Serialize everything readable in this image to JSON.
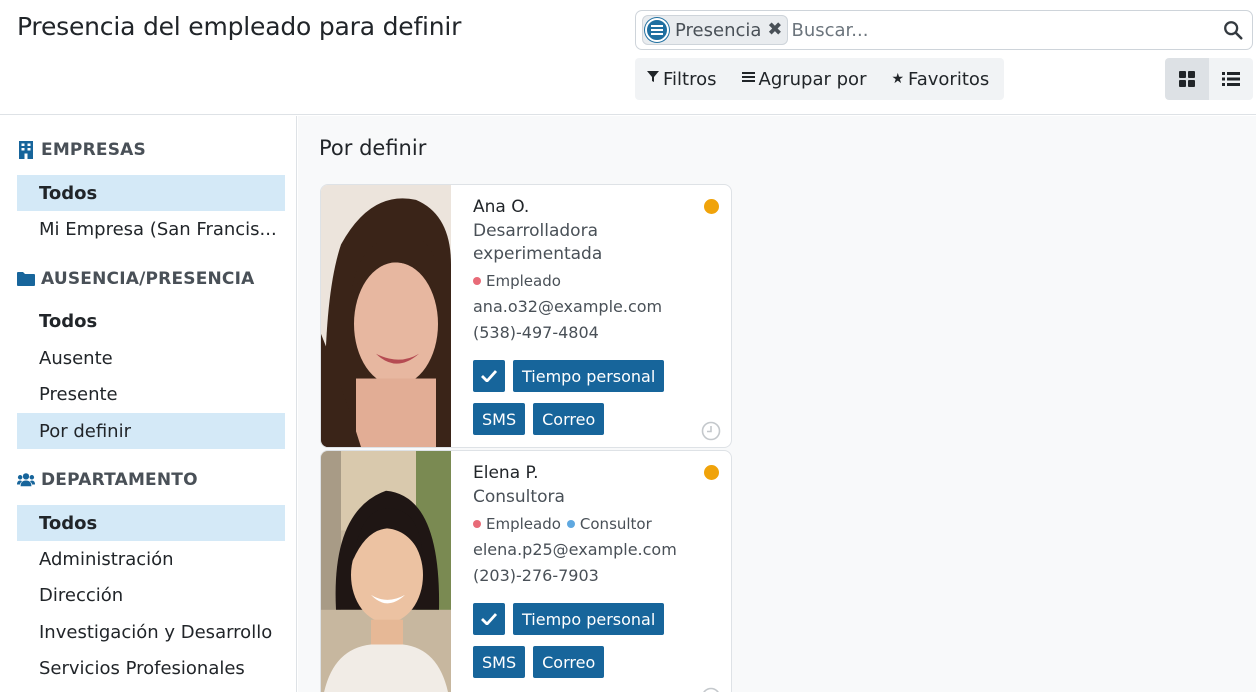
{
  "header": {
    "title": "Presencia del empleado para definir"
  },
  "search": {
    "facet_label": "Presencia",
    "placeholder": "Buscar..."
  },
  "filters": {
    "filters_label": "Filtros",
    "groupby_label": "Agrupar por",
    "favorites_label": "Favoritos"
  },
  "sidebar": {
    "sections": [
      {
        "title": "EMPRESAS",
        "items": [
          "Todos",
          "Mi Empresa (San Francis..."
        ]
      },
      {
        "title": "AUSENCIA/PRESENCIA",
        "items": [
          "Todos",
          "Ausente",
          "Presente",
          "Por definir"
        ]
      },
      {
        "title": "DEPARTAMENTO",
        "items": [
          "Todos",
          "Administración",
          "Dirección",
          "Investigación y Desarrollo",
          "Servicios Profesionales"
        ]
      }
    ]
  },
  "main": {
    "group_title": "Por definir",
    "cards": [
      {
        "name": "Ana O.",
        "job": "Desarrolladora experimentada",
        "tags": [
          "Empleado"
        ],
        "email": "ana.o32@example.com",
        "phone": "(538)-497-4804",
        "btn_personal": "Tiempo personal",
        "btn_sms": "SMS",
        "btn_mail": "Correo"
      },
      {
        "name": "Elena P.",
        "job": "Consultora",
        "tags": [
          "Empleado",
          "Consultor"
        ],
        "email": "elena.p25@example.com",
        "phone": "(203)-276-7903",
        "btn_personal": "Tiempo personal",
        "btn_sms": "SMS",
        "btn_mail": "Correo"
      }
    ]
  },
  "colors": {
    "accent": "#17659b",
    "active_bg": "#d4e9f7",
    "status_to_define": "#f0a30a",
    "tag_employee": "#e86b78",
    "tag_consultant": "#5fa8e0"
  }
}
